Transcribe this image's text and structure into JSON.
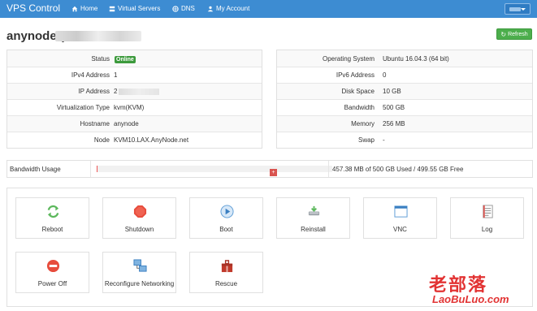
{
  "navbar": {
    "brand": "VPS Control",
    "items": [
      {
        "label": "Home",
        "icon": "home-icon"
      },
      {
        "label": "Virtual Servers",
        "icon": "servers-icon"
      },
      {
        "label": "DNS",
        "icon": "globe-icon"
      },
      {
        "label": "My Account",
        "icon": "user-icon"
      }
    ]
  },
  "header": {
    "title": "anynode (21",
    "refresh_label": "Refresh"
  },
  "info_left": [
    {
      "label": "Status",
      "value": "Online",
      "type": "badge"
    },
    {
      "label": "IPv4 Address",
      "value": "1"
    },
    {
      "label": "IP Address",
      "value": "2",
      "blurred": true
    },
    {
      "label": "Virtualization Type",
      "value": "kvm(KVM)"
    },
    {
      "label": "Hostname",
      "value": "anynode"
    },
    {
      "label": "Node",
      "value": "KVM10.LAX.AnyNode.net"
    }
  ],
  "info_right": [
    {
      "label": "Operating System",
      "value": "Ubuntu 16.04.3 (64 bit)"
    },
    {
      "label": "IPv6 Address",
      "value": "0"
    },
    {
      "label": "Disk Space",
      "value": "10 GB"
    },
    {
      "label": "Bandwidth",
      "value": "500 GB"
    },
    {
      "label": "Memory",
      "value": "256 MB"
    },
    {
      "label": "Swap",
      "value": "-"
    }
  ],
  "bandwidth": {
    "label": "Bandwidth Usage",
    "usage_text": "457.38 MB of 500 GB Used / 499.55 GB Free",
    "used_fraction": 0.0009
  },
  "actions": [
    {
      "label": "Reboot",
      "icon": "reboot-icon"
    },
    {
      "label": "Shutdown",
      "icon": "shutdown-icon"
    },
    {
      "label": "Boot",
      "icon": "boot-icon"
    },
    {
      "label": "Reinstall",
      "icon": "reinstall-icon"
    },
    {
      "label": "VNC",
      "icon": "vnc-icon"
    },
    {
      "label": "Log",
      "icon": "log-icon"
    },
    {
      "label": "Power Off",
      "icon": "power-off-icon"
    },
    {
      "label": "Reconfigure Networking",
      "icon": "network-icon"
    },
    {
      "label": "Rescue",
      "icon": "rescue-icon"
    }
  ],
  "watermark": {
    "cn": "老部落",
    "en": "LaoBuLuo.com"
  },
  "colors": {
    "navbar": "#3d8cd2",
    "online": "#3c9a3c",
    "refresh": "#4cae4c",
    "watermark": "#e23333"
  }
}
